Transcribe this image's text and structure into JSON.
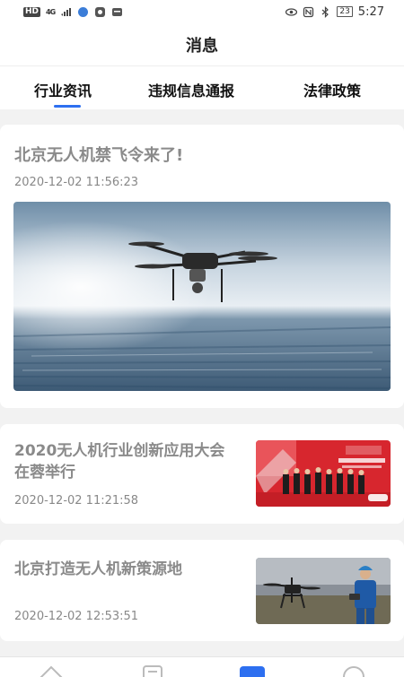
{
  "status_bar": {
    "left_badge": "HD",
    "signal_text": "4G",
    "battery": "23",
    "time": "5:27"
  },
  "header": {
    "title": "消息"
  },
  "tabs": [
    {
      "label": "行业资讯",
      "active": true
    },
    {
      "label": "违规信息通报",
      "active": false
    },
    {
      "label": "法律政策",
      "active": false
    }
  ],
  "accent_color": "#2d6ff0",
  "news": [
    {
      "title": "北京无人机禁飞令来了!",
      "time": "2020-12-02 11:56:23",
      "image": "drone-flying-over-city"
    },
    {
      "title": "2020无人机行业创新应用大会在蓉举行",
      "time": "2020-12-02 11:21:58",
      "image": "conference-group-photo"
    },
    {
      "title": "北京打造无人机新策源地",
      "time": "2020-12-02 12:53:51",
      "image": "pilot-with-drone"
    }
  ],
  "bottom_nav": [
    {
      "icon": "home-icon"
    },
    {
      "icon": "document-icon"
    },
    {
      "icon": "message-icon",
      "active": true
    },
    {
      "icon": "profile-icon"
    }
  ]
}
